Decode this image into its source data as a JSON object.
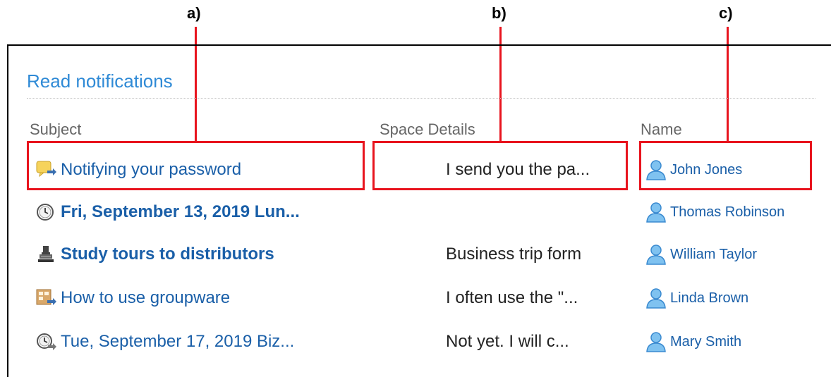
{
  "callouts": {
    "a": "a)",
    "b": "b)",
    "c": "c)"
  },
  "section": {
    "title": "Read notifications"
  },
  "columns": {
    "subject": "Subject",
    "details": "Space Details",
    "name": "Name"
  },
  "rows": [
    {
      "icon": "message-icon",
      "subject": "Notifying your password",
      "bold": false,
      "details": "I send you the pa...",
      "name": "John Jones"
    },
    {
      "icon": "schedule-clock-icon",
      "subject": "Fri, September 13, 2019 Lun...",
      "bold": true,
      "details": "",
      "name": "Thomas Robinson"
    },
    {
      "icon": "workflow-stamp-icon",
      "subject": "Study tours to distributors",
      "bold": true,
      "details": "Business trip form",
      "name": "William Taylor"
    },
    {
      "icon": "space-discussion-icon",
      "subject": "How to use groupware",
      "bold": false,
      "details": "I often use the \"...",
      "name": "Linda Brown"
    },
    {
      "icon": "schedule-clock-icon",
      "subject": "Tue, September 17, 2019 Biz...",
      "bold": false,
      "details": "Not yet. I will c...",
      "name": "Mary Smith"
    }
  ],
  "colors": {
    "accent": "#2f8ad6",
    "link": "#1a5fa8",
    "callout": "#e8141e"
  }
}
